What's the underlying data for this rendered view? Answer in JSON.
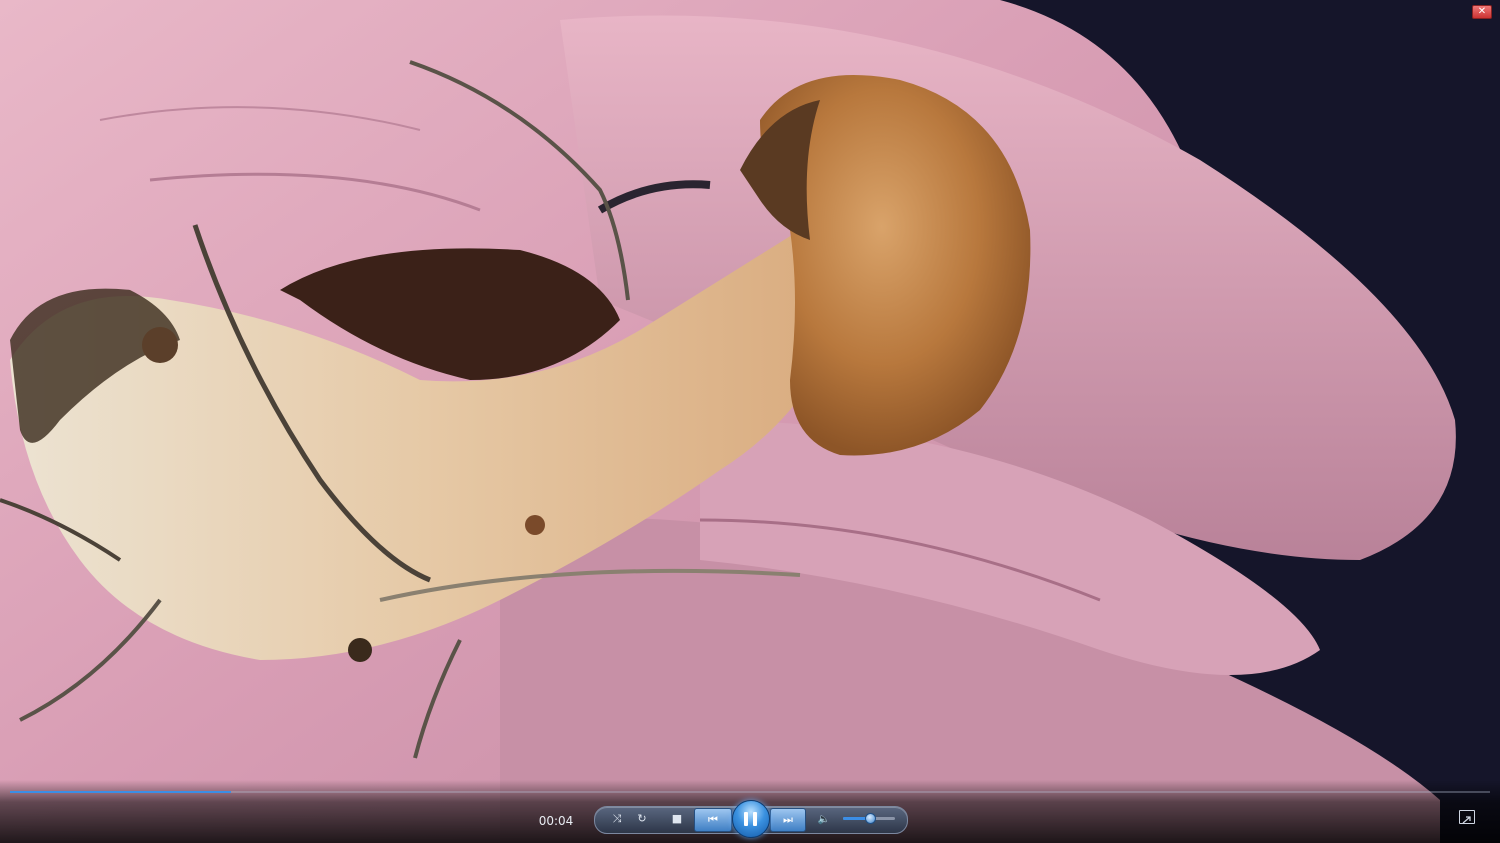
{
  "player": {
    "elapsed_time": "00:04",
    "seek_progress": 0.149,
    "volume_level": 0.5,
    "state": "playing",
    "accent_color": "#3b8ee6",
    "close_glyph": "✕"
  },
  "controls": {
    "shuffle_glyph": "⤨",
    "repeat_glyph": "↻",
    "stop_glyph": "■",
    "previous_glyph": "⏮",
    "next_glyph": "⏭",
    "volume_glyph": "🔈"
  },
  "icons": {
    "close": "close-icon",
    "shuffle": "shuffle-icon",
    "repeat": "repeat-icon",
    "stop": "stop-icon",
    "previous": "previous-icon",
    "pause": "pause-icon",
    "next": "next-icon",
    "volume": "speaker-icon",
    "fullscreen": "fullscreen-icon"
  }
}
